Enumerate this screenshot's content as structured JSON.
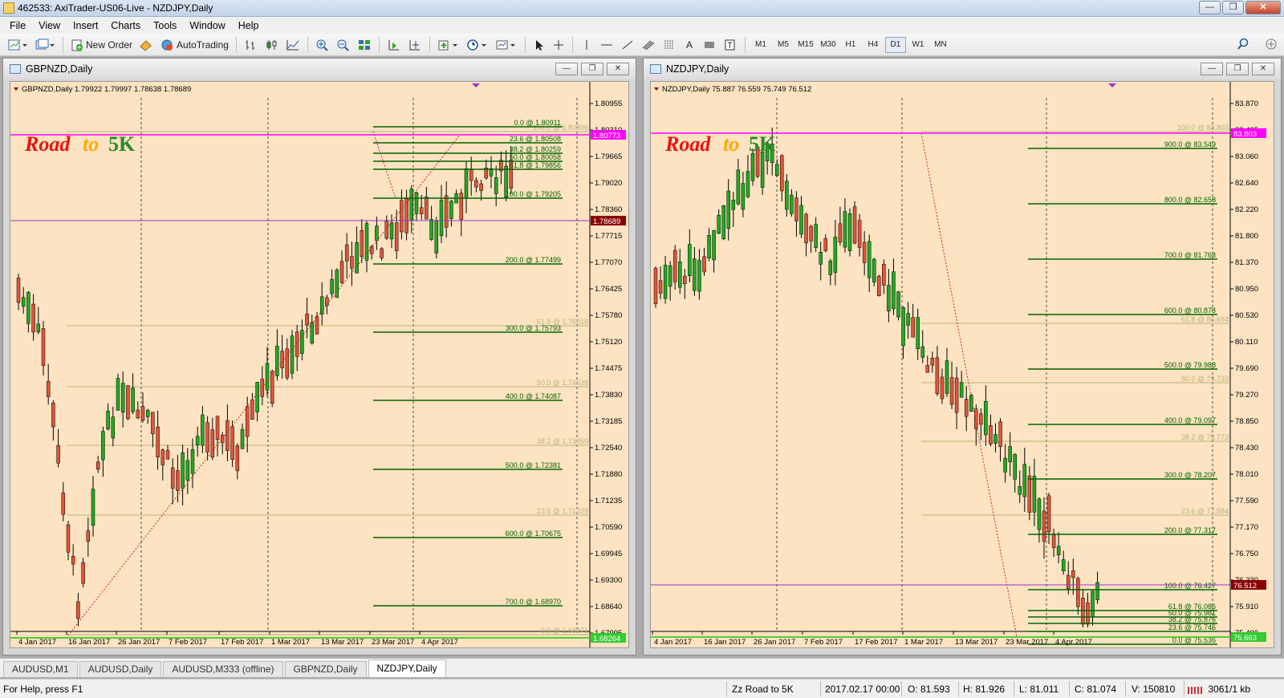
{
  "window": {
    "title": "462533: AxiTrader-US06-Live - NZDJPY,Daily"
  },
  "menu": [
    "File",
    "View",
    "Insert",
    "Charts",
    "Tools",
    "Window",
    "Help"
  ],
  "toolbar": {
    "new_order": "New Order",
    "auto_trading": "AutoTrading",
    "timeframes": [
      "M1",
      "M5",
      "M15",
      "M30",
      "H1",
      "H4",
      "D1",
      "W1",
      "MN"
    ],
    "active_timeframe": "D1"
  },
  "charts": [
    {
      "window_title": "GBPNZD,Daily",
      "info": "GBPNZD,Daily  1.79922 1.79997 1.78638 1.78689",
      "watermark": [
        "Road",
        "to",
        "5K"
      ],
      "price_axis": [
        "1.80955",
        "1.80310",
        "1.79665",
        "1.79020",
        "1.78360",
        "1.77715",
        "1.77070",
        "1.76425",
        "1.75780",
        "1.75120",
        "1.74475",
        "1.73830",
        "1.73185",
        "1.72540",
        "1.71880",
        "1.71235",
        "1.70590",
        "1.69945",
        "1.69300",
        "1.68640",
        "1.67995"
      ],
      "date_axis": [
        "4 Jan 2017",
        "16 Jan 2017",
        "26 Jan 2017",
        "7 Feb 2017",
        "17 Feb 2017",
        "1 Mar 2017",
        "13 Mar 2017",
        "23 Mar 2017",
        "4 Apr 2017"
      ],
      "price_tags": [
        {
          "text": "1.80773",
          "color": "#ff00ff"
        },
        {
          "text": "1.78689",
          "color": "#8b0000"
        },
        {
          "text": "1.68264",
          "color": "#33cc33"
        }
      ],
      "fib_levels_green": [
        "0.0 @ 1.80911",
        "23.6 @ 1.80508",
        "38.2 @ 1.80259",
        "50.0 @ 1.80058",
        "61.8 @ 1.79856",
        "100.0 @ 1.79205",
        "200.0 @ 1.77499",
        "300.0 @ 1.75793",
        "400.0 @ 1.74087",
        "500.0 @ 1.72381",
        "600.0 @ 1.70675",
        "700.0 @ 1.68970"
      ],
      "fib_levels_olive": [
        "100.0 @ 1.80806",
        "61.8 @ 1.76018",
        "50.0 @ 1.74538",
        "38.2 @ 1.73059",
        "23.6 @ 1.71229",
        "0.0 @ 1.68271"
      ]
    },
    {
      "window_title": "NZDJPY,Daily",
      "info": "NZDJPY,Daily  75.887 76.559 75.749 76.512",
      "watermark": [
        "Road",
        "to",
        "5K"
      ],
      "price_axis": [
        "83.870",
        "83.485",
        "83.060",
        "82.640",
        "82.220",
        "81.800",
        "81.370",
        "80.950",
        "80.530",
        "80.110",
        "79.690",
        "79.270",
        "78.850",
        "78.430",
        "78.010",
        "77.590",
        "77.170",
        "76.750",
        "76.330",
        "75.910",
        "75.490"
      ],
      "date_axis": [
        "4 Jan 2017",
        "16 Jan 2017",
        "26 Jan 2017",
        "7 Feb 2017",
        "17 Feb 2017",
        "1 Mar 2017",
        "13 Mar 2017",
        "23 Mar 2017",
        "4 Apr 2017"
      ],
      "price_tags": [
        {
          "text": "83.803",
          "color": "#ff00ff"
        },
        {
          "text": "76.512",
          "color": "#8b0000"
        },
        {
          "text": "75.663",
          "color": "#33cc33"
        }
      ],
      "fib_levels_green": [
        "900.0 @ 83.549",
        "800.0 @ 82.658",
        "700.0 @ 81.768",
        "600.0 @ 80.878",
        "500.0 @ 79.988",
        "400.0 @ 79.097",
        "300.0 @ 78.207",
        "200.0 @ 77.317",
        "100.0 @ 76.427",
        "61.8 @ 76.086",
        "50.0 @ 75.981",
        "38.2 @ 75.876",
        "23.6 @ 75.746",
        "0.0 @ 75.536"
      ],
      "fib_levels_olive": [
        "100.0 @ 83.803",
        "61.8 @ 80.694",
        "50.0 @ 79.733",
        "38.2 @ 78.773",
        "23.6 @ 77.584"
      ]
    }
  ],
  "tabs": [
    "AUDUSD,M1",
    "AUDUSD,Daily",
    "AUDUSD,M333 (offline)",
    "GBPNZD,Daily",
    "NZDJPY,Daily"
  ],
  "active_tab": "NZDJPY,Daily",
  "status": {
    "help": "For Help, press F1",
    "profile": "Zz Road to 5K",
    "datetime": "2017.02.17 00:00",
    "open": "O: 81.593",
    "high": "H: 81.926",
    "low": "L: 81.011",
    "close": "C: 81.074",
    "volume": "V: 150810",
    "traffic": "3061/1 kb"
  },
  "colors": {
    "chart_bg": "#fde3c1",
    "bull_candle": "#22aa22",
    "bear_candle": "#e2553a",
    "fib_green": "#006400",
    "fib_olive": "#b5b57a",
    "magenta_line": "#ff00ff",
    "purple_line": "#9933cc"
  }
}
